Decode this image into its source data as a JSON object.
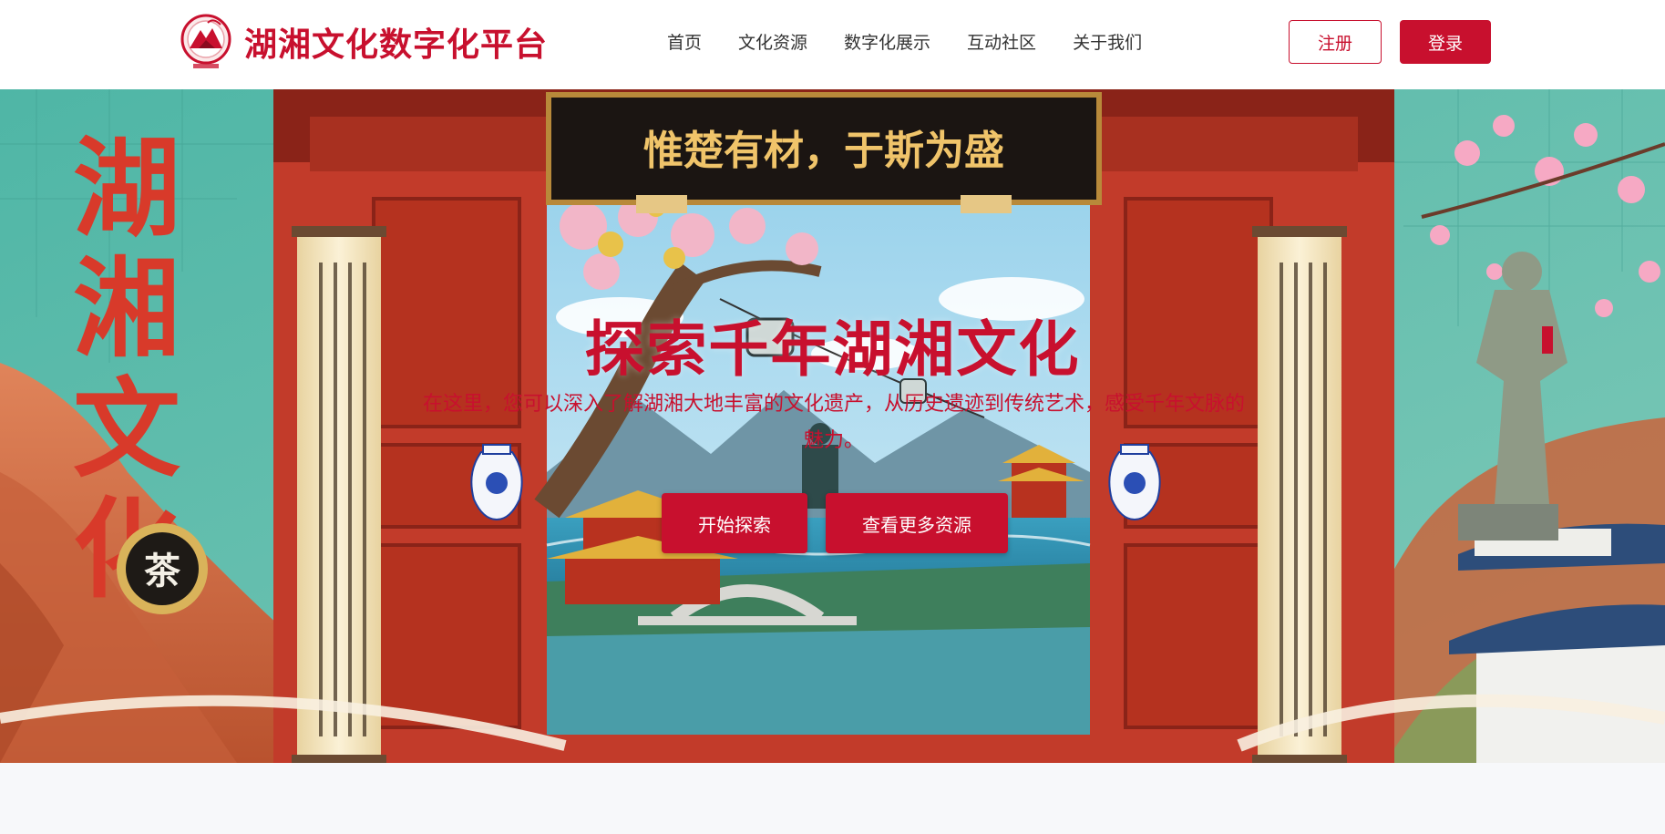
{
  "header": {
    "brand_title": "湖湘文化数字化平台",
    "nav": [
      {
        "label": "首页"
      },
      {
        "label": "文化资源"
      },
      {
        "label": "数字化展示"
      },
      {
        "label": "互动社区"
      },
      {
        "label": "关于我们"
      }
    ],
    "register_label": "注册",
    "login_label": "登录"
  },
  "hero": {
    "plaque_text": "惟楚有材，于斯为盛",
    "side_calligraphy": "湖湘文化",
    "tea_badge": "茶",
    "title": "探索千年湖湘文化",
    "subtitle": "在这里，您可以深入了解湖湘大地丰富的文化遗产，从历史遗迹到传统艺术，感受千年文脉的魅力。",
    "primary_button": "开始探索",
    "secondary_button": "查看更多资源"
  },
  "colors": {
    "brand": "#c8102e",
    "header_bg": "#ffffff",
    "page_bg": "#f7f8fa"
  },
  "icons": {
    "logo": "mountain-seal-logo"
  }
}
